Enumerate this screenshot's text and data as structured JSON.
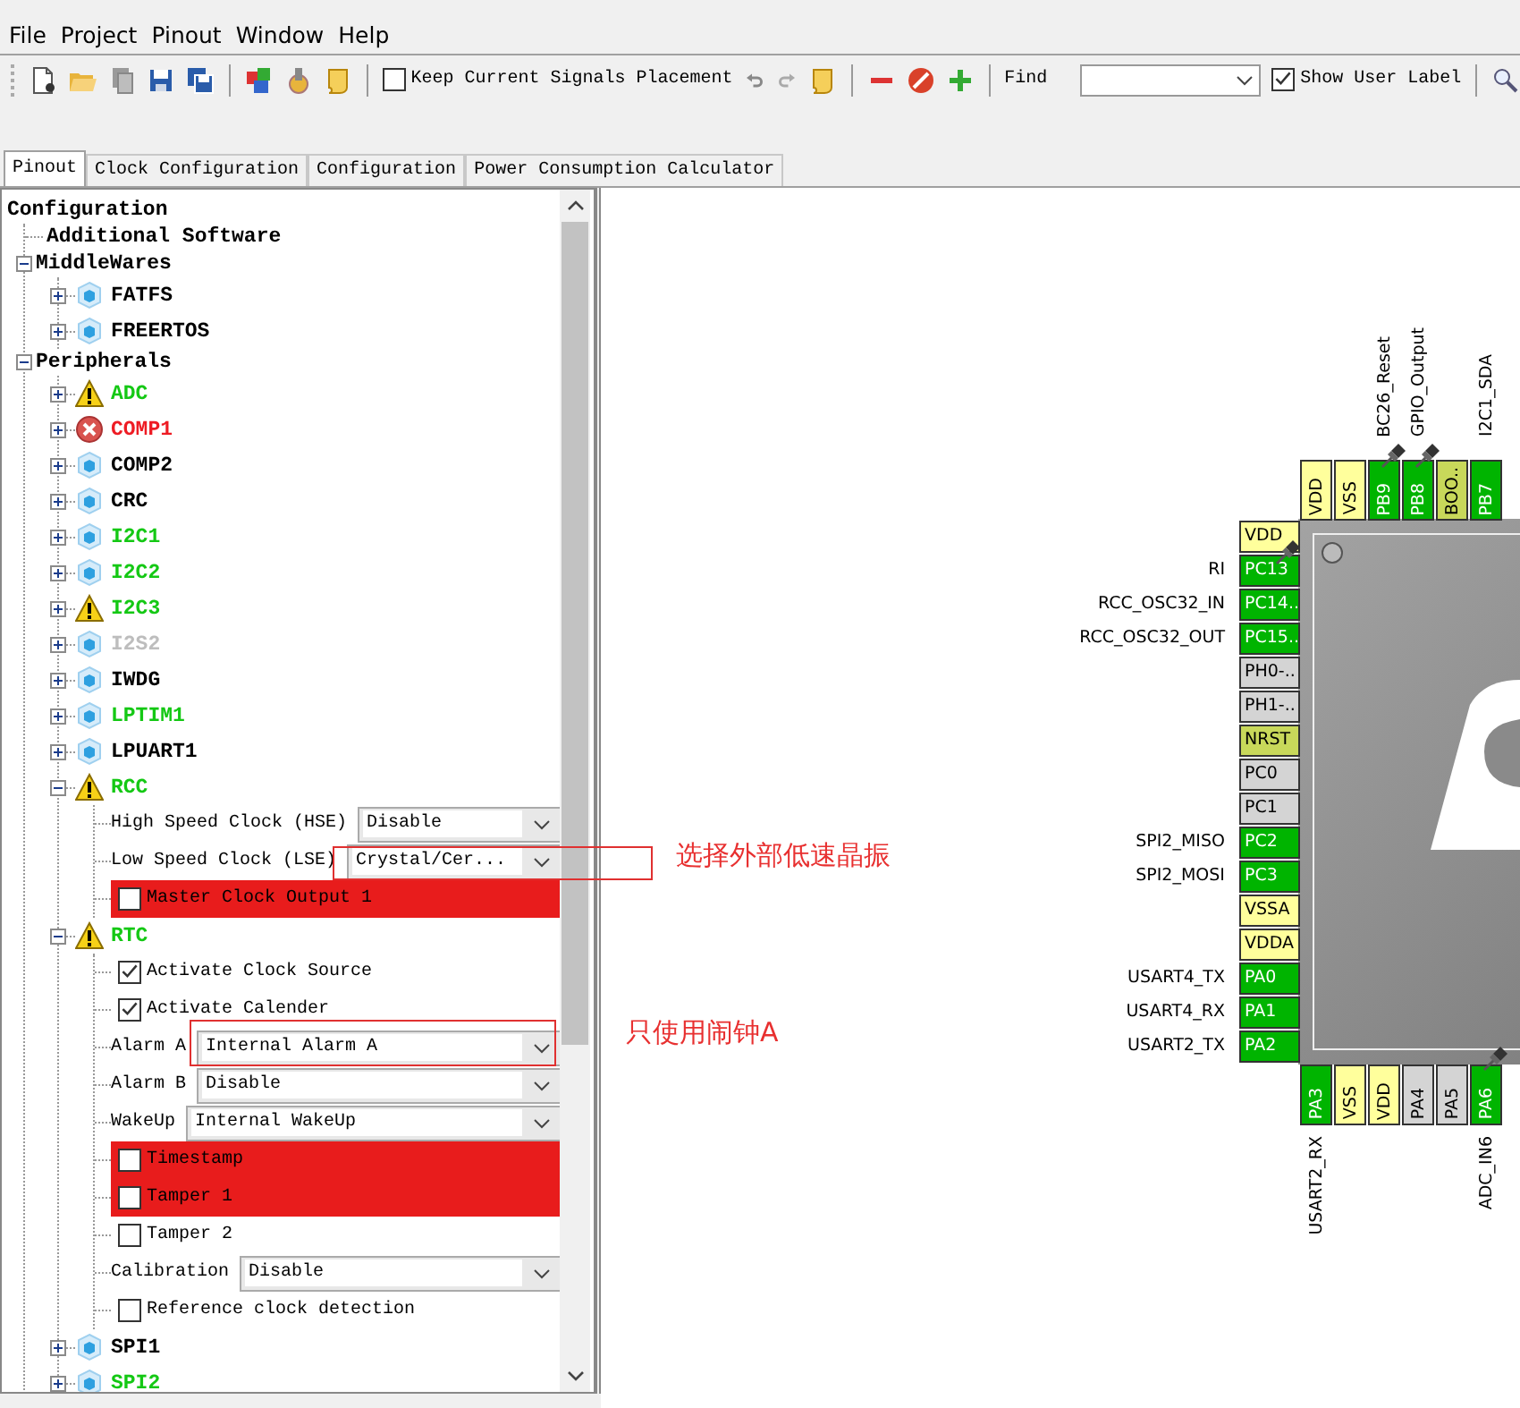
{
  "menu": [
    "File",
    "Project",
    "Pinout",
    "Window",
    "Help"
  ],
  "toolbar": {
    "keep_placement": {
      "label": "Keep Current Signals Placement",
      "checked": false
    },
    "find": {
      "label": "Find"
    },
    "show_user_label": {
      "label": "Show User Label",
      "checked": true
    }
  },
  "tabs": [
    {
      "label": "Pinout",
      "selected": true
    },
    {
      "label": "Clock Configuration",
      "selected": false
    },
    {
      "label": "Configuration",
      "selected": false
    },
    {
      "label": "Power Consumption Calculator",
      "selected": false
    }
  ],
  "tree": {
    "label": "Configuration",
    "children": [
      {
        "label": "Additional Software"
      },
      {
        "label": "MiddleWares",
        "expanded": true,
        "children": [
          {
            "label": "FATFS",
            "kind": "plain",
            "color": "#000000",
            "expanded": false
          },
          {
            "label": "FREERTOS",
            "kind": "plain",
            "color": "#000000",
            "expanded": false
          }
        ]
      },
      {
        "label": "Peripherals",
        "expanded": true,
        "children": [
          {
            "label": "ADC",
            "kind": "warning",
            "color": "#14c814",
            "expanded": false
          },
          {
            "label": "COMP1",
            "kind": "error",
            "color": "#ee1c24",
            "expanded": false
          },
          {
            "label": "COMP2",
            "kind": "plain",
            "color": "#000000",
            "expanded": false
          },
          {
            "label": "CRC",
            "kind": "plain",
            "color": "#000000",
            "expanded": false
          },
          {
            "label": "I2C1",
            "kind": "plain",
            "color": "#14c814",
            "expanded": false
          },
          {
            "label": "I2C2",
            "kind": "plain",
            "color": "#14c814",
            "expanded": false
          },
          {
            "label": "I2C3",
            "kind": "warning",
            "color": "#14c814",
            "expanded": false
          },
          {
            "label": "I2S2",
            "kind": "plain",
            "color": "#bdbdbd",
            "expanded": false
          },
          {
            "label": "IWDG",
            "kind": "plain",
            "color": "#000000",
            "expanded": false
          },
          {
            "label": "LPTIM1",
            "kind": "plain",
            "color": "#14c814",
            "expanded": false
          },
          {
            "label": "LPUART1",
            "kind": "plain",
            "color": "#000000",
            "expanded": false
          },
          {
            "label": "RCC",
            "kind": "warning",
            "color": "#14c814",
            "expanded": true,
            "settings": [
              {
                "kind": "dropdown",
                "label": "High Speed Clock (HSE)",
                "value": "Disable"
              },
              {
                "kind": "dropdown",
                "label": "Low Speed Clock (LSE)",
                "value": "Crystal/Cer..."
              },
              {
                "kind": "checkbox",
                "label": "Master Clock Output 1",
                "checked": false,
                "conflict": true
              }
            ]
          },
          {
            "label": "RTC",
            "kind": "warning",
            "color": "#14c814",
            "expanded": true,
            "settings": [
              {
                "kind": "checkbox",
                "label": "Activate Clock Source",
                "checked": true,
                "conflict": false
              },
              {
                "kind": "checkbox",
                "label": "Activate Calender",
                "checked": true,
                "conflict": false
              },
              {
                "kind": "dropdown",
                "label": "Alarm A",
                "value": "Internal Alarm A"
              },
              {
                "kind": "dropdown",
                "label": "Alarm B",
                "value": "Disable"
              },
              {
                "kind": "dropdown",
                "label": "WakeUp",
                "value": "Internal WakeUp"
              },
              {
                "kind": "checkbox",
                "label": "Timestamp",
                "checked": false,
                "conflict": true
              },
              {
                "kind": "checkbox",
                "label": "Tamper 1",
                "checked": false,
                "conflict": true
              },
              {
                "kind": "checkbox",
                "label": "Tamper 2",
                "checked": false,
                "conflict": false
              },
              {
                "kind": "dropdown",
                "label": "Calibration",
                "value": "Disable"
              },
              {
                "kind": "checkbox",
                "label": "Reference clock detection",
                "checked": false,
                "conflict": false
              }
            ]
          },
          {
            "label": "SPI1",
            "kind": "plain",
            "color": "#000000",
            "expanded": false
          },
          {
            "label": "SPI2",
            "kind": "plain",
            "color": "#14c814",
            "expanded": false
          }
        ]
      }
    ]
  },
  "chip": {
    "top_pins": [
      {
        "name": "VDD",
        "kind": "power",
        "pinned": false
      },
      {
        "name": "VSS",
        "kind": "power",
        "pinned": false
      },
      {
        "name": "PB9",
        "kind": "assigned",
        "pinned": true,
        "signal": "BC26_Reset"
      },
      {
        "name": "PB8",
        "kind": "assigned",
        "pinned": true,
        "signal": "GPIO_Output"
      },
      {
        "name": "BOO..",
        "kind": "special",
        "pinned": false
      },
      {
        "name": "PB7",
        "kind": "assigned",
        "pinned": false,
        "signal": "I2C1_SDA"
      }
    ],
    "left_pins": [
      {
        "name": "VDD",
        "kind": "power",
        "pinned": false
      },
      {
        "name": "PC13",
        "kind": "assigned",
        "pinned": true,
        "signal": "RI"
      },
      {
        "name": "PC14..",
        "kind": "assigned",
        "pinned": false,
        "signal": "RCC_OSC32_IN"
      },
      {
        "name": "PC15..",
        "kind": "assigned",
        "pinned": false,
        "signal": "RCC_OSC32_OUT"
      },
      {
        "name": "PH0-..",
        "kind": "free",
        "pinned": false
      },
      {
        "name": "PH1-..",
        "kind": "free",
        "pinned": false
      },
      {
        "name": "NRST",
        "kind": "special",
        "pinned": false
      },
      {
        "name": "PC0",
        "kind": "free",
        "pinned": false
      },
      {
        "name": "PC1",
        "kind": "free",
        "pinned": false
      },
      {
        "name": "PC2",
        "kind": "assigned",
        "pinned": false,
        "signal": "SPI2_MISO"
      },
      {
        "name": "PC3",
        "kind": "assigned",
        "pinned": false,
        "signal": "SPI2_MOSI"
      },
      {
        "name": "VSSA",
        "kind": "power",
        "pinned": false
      },
      {
        "name": "VDDA",
        "kind": "power",
        "pinned": false
      },
      {
        "name": "PA0",
        "kind": "assigned",
        "pinned": false,
        "signal": "USART4_TX"
      },
      {
        "name": "PA1",
        "kind": "assigned",
        "pinned": false,
        "signal": "USART4_RX"
      },
      {
        "name": "PA2",
        "kind": "assigned",
        "pinned": false,
        "signal": "USART2_TX"
      }
    ],
    "bottom_pins": [
      {
        "name": "PA3",
        "kind": "assigned",
        "pinned": false,
        "signal": "USART2_RX"
      },
      {
        "name": "VSS",
        "kind": "power",
        "pinned": false
      },
      {
        "name": "VDD",
        "kind": "power",
        "pinned": false
      },
      {
        "name": "PA4",
        "kind": "free",
        "pinned": false
      },
      {
        "name": "PA5",
        "kind": "free",
        "pinned": false
      },
      {
        "name": "PA6",
        "kind": "assigned",
        "pinned": true,
        "signal": "ADC_IN6"
      }
    ]
  },
  "annotations": [
    {
      "text": "选择外部低速晶振"
    },
    {
      "text": "只使用闹钟A"
    }
  ]
}
